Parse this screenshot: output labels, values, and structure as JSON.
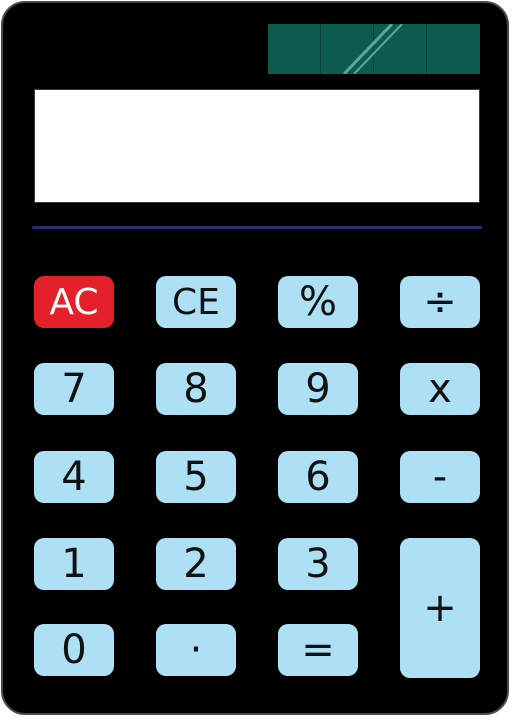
{
  "colors": {
    "body": "#000000",
    "key": "#aee0f5",
    "clear_key": "#e4202a",
    "solar_panel": "#0b5b4f",
    "display": "#ffffff",
    "divider": "#2c2a70"
  },
  "display": {
    "value": ""
  },
  "keys": {
    "ac": "AC",
    "ce": "CE",
    "percent": "%",
    "divide": "÷",
    "seven": "7",
    "eight": "8",
    "nine": "9",
    "multiply": "x",
    "four": "4",
    "five": "5",
    "six": "6",
    "minus": "-",
    "one": "1",
    "two": "2",
    "three": "3",
    "plus": "+",
    "zero": "0",
    "decimal": "·",
    "equals": "="
  }
}
